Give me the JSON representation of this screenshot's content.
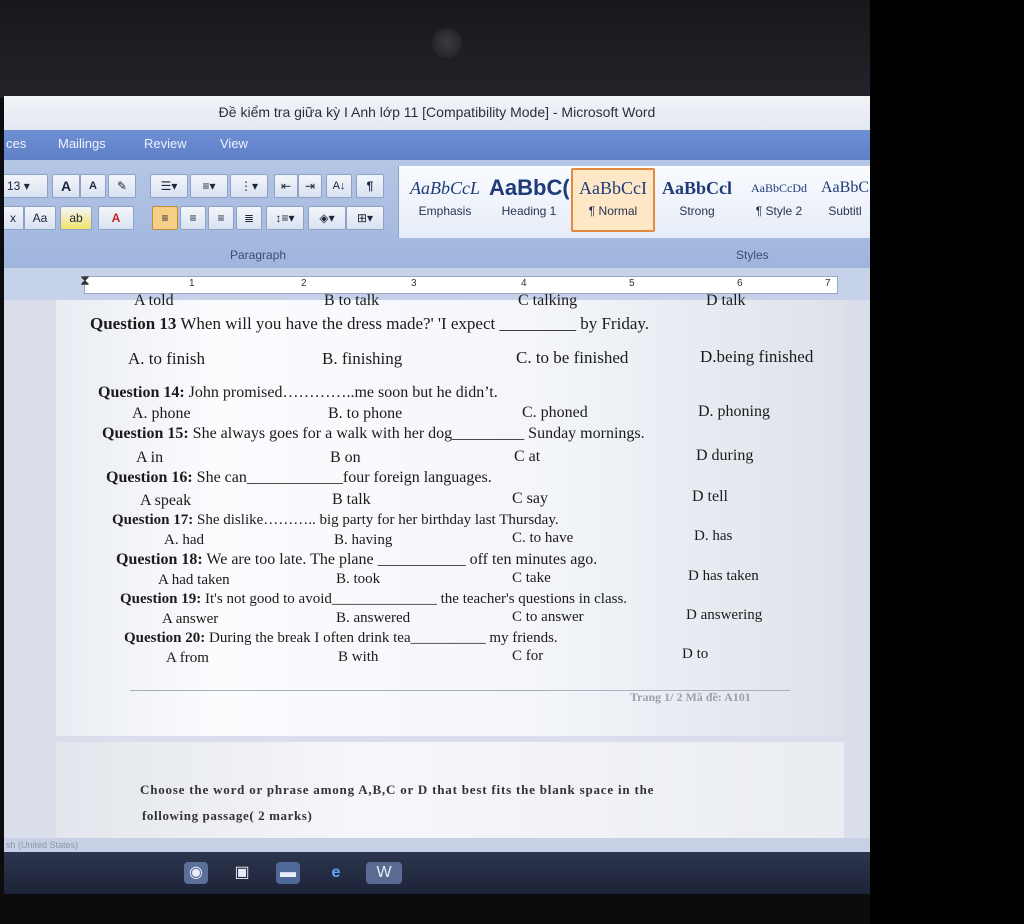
{
  "window": {
    "title": "Đề kiểm tra giữa kỳ I Anh lớp 11 [Compatibility Mode] - Microsoft Word"
  },
  "menu": {
    "items": [
      "ces",
      "Mailings",
      "Review",
      "View"
    ]
  },
  "ribbon": {
    "font_size": "13",
    "grow_font": "A",
    "shrink_font": "A",
    "case_button": "Aa",
    "sub_label": "x",
    "highlight_label": "ab",
    "font_color_label": "A",
    "paragraph_mark": "¶",
    "sort_label": "A↓",
    "paragraph_group": "Paragraph",
    "styles_group": "Styles",
    "styles": [
      {
        "sample": "AaBbCcL",
        "name": "Emphasis"
      },
      {
        "sample": "AaBbC(",
        "name": "Heading 1"
      },
      {
        "sample": "AaBbCcI",
        "name": "¶ Normal"
      },
      {
        "sample": "AaBbCcl",
        "name": "Strong"
      },
      {
        "sample": "AaBbCcDd",
        "name": "¶ Style 2"
      },
      {
        "sample": "AaBbC",
        "name": "Subtitl"
      }
    ]
  },
  "ruler": {
    "numbers": [
      "1",
      "2",
      "3",
      "4",
      "5",
      "6",
      "7"
    ]
  },
  "document": {
    "cut_options": [
      "A told",
      "B to talk",
      "C talking",
      "D talk"
    ],
    "questions": [
      {
        "label": "Question 13",
        "text": "When will you have the dress made?' 'I expect _________ by Friday.",
        "options": [
          "A. to finish",
          "B. finishing",
          "C. to be finished",
          "D.being finished"
        ]
      },
      {
        "label": "Question 14:",
        "text": "John promised…………..me soon but he didn’t.",
        "options": [
          "A. phone",
          "B. to phone",
          "C. phoned",
          "D. phoning"
        ]
      },
      {
        "label": "Question 15:",
        "text": "She always goes for a walk with her dog_________ Sunday mornings.",
        "options": [
          "A in",
          "B on",
          "C at",
          "D during"
        ]
      },
      {
        "label": "Question 16:",
        "text": "She can____________four foreign languages.",
        "options": [
          "A speak",
          "B talk",
          "C say",
          "D tell"
        ]
      },
      {
        "label": "Question 17:",
        "text": "She dislike……….. big party for her birthday last Thursday.",
        "options": [
          "A. had",
          "B. having",
          "C. to have",
          "D. has"
        ]
      },
      {
        "label": "Question 18:",
        "text": "We are too late. The plane ___________ off ten minutes ago.",
        "options": [
          "A had taken",
          "B. took",
          "C take",
          "D has taken"
        ]
      },
      {
        "label": "Question 19:",
        "text": "It's not good to avoid______________ the teacher's questions in class.",
        "options": [
          "A answer",
          "B. answered",
          "C to answer",
          "D answering"
        ]
      },
      {
        "label": "Question 20:",
        "text": "During the break I often drink tea__________ my friends.",
        "options": [
          "A from",
          "B with",
          "C for",
          "D to"
        ]
      }
    ],
    "footer": "Trang 1/ 2 Mã đề: A101",
    "passage_instruction_1": "Choose the word or phrase among A,B,C or D that best fits the blank space in the",
    "passage_instruction_2": "following passage( 2 marks)"
  },
  "statusbar": {
    "language": "sh (United States)"
  }
}
